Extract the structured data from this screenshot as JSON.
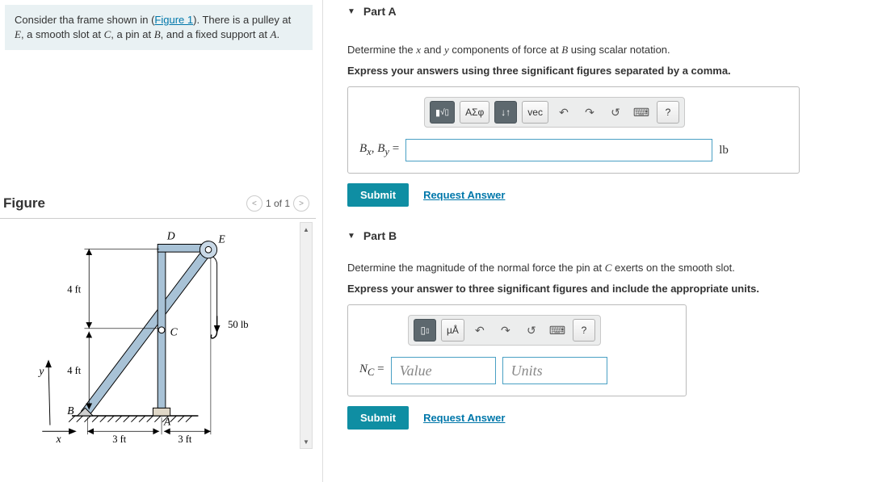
{
  "problem": {
    "text_pre": "Consider tha frame shown in (",
    "figure_link": "Figure 1",
    "text_post": "). There is a pulley at ",
    "e": "E",
    "mid1": ", a smooth slot at ",
    "c": "C",
    "mid2": ", a pin at ",
    "b": "B",
    "mid3": ", and a fixed support at ",
    "a": "A",
    "end": "."
  },
  "figure": {
    "title": "Figure",
    "nav_text": "1 of 1",
    "labels": {
      "D": "D",
      "E": "E",
      "C": "C",
      "A": "A",
      "B": "B",
      "x": "x",
      "y": "y"
    },
    "dims": {
      "v1": "4 ft",
      "v2": "4 ft",
      "h1": "3 ft",
      "h2": "3 ft",
      "load": "50 lb"
    }
  },
  "partA": {
    "title": "Part A",
    "q1_pre": "Determine the ",
    "q1_x": "x",
    "q1_mid": " and ",
    "q1_y": "y",
    "q1_mid2": " components of force at ",
    "q1_b": "B",
    "q1_post": " using scalar notation.",
    "q2": "Express your answers using three significant figures separated by a comma.",
    "lhs": "Bₓ, Bᵧ =",
    "unit": "lb",
    "toolbar": {
      "templates": "▮√▯",
      "greek": "ΑΣφ",
      "updown": "↓↑",
      "vec": "vec",
      "help": "?"
    },
    "submit": "Submit",
    "request": "Request Answer"
  },
  "partB": {
    "title": "Part B",
    "q1_pre": "Determine the magnitude of the normal force the pin at ",
    "q1_c": "C",
    "q1_post": " exerts on the smooth slot.",
    "q2": "Express your answer to three significant figures and include the appropriate units.",
    "lhs": "N_C =",
    "value_ph": "Value",
    "units_ph": "Units",
    "toolbar": {
      "units": "µÅ",
      "help": "?"
    },
    "submit": "Submit",
    "request": "Request Answer"
  }
}
